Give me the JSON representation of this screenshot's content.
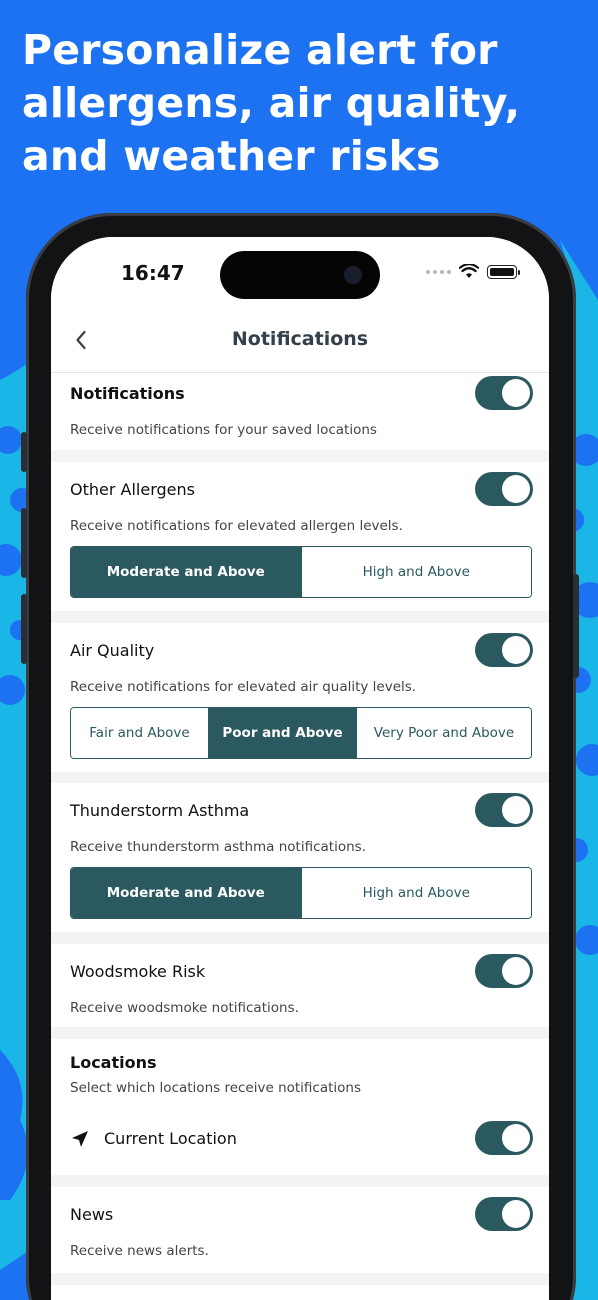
{
  "headline": "Personalize alert for allergens, air quality, and weather risks",
  "status_bar": {
    "time": "16:47"
  },
  "nav": {
    "title": "Notifications",
    "back_icon": "chevron-left-icon"
  },
  "colors": {
    "background": "#1d72f2",
    "accent": "#2a5960",
    "decor": "#1ab6e8"
  },
  "sections": {
    "notifications": {
      "title": "Notifications",
      "description": "Receive notifications for your saved locations",
      "enabled": true
    },
    "other_allergens": {
      "title": "Other Allergens",
      "description": "Receive notifications for elevated allergen levels.",
      "enabled": true,
      "options": [
        "Moderate and Above",
        "High and Above"
      ],
      "selected": "Moderate and Above"
    },
    "air_quality": {
      "title": "Air Quality",
      "description": "Receive notifications for elevated air quality levels.",
      "enabled": true,
      "options": [
        "Fair and Above",
        "Poor and Above",
        "Very Poor and Above"
      ],
      "selected": "Poor and Above"
    },
    "thunderstorm_asthma": {
      "title": "Thunderstorm Asthma",
      "description": "Receive thunderstorm asthma notifications.",
      "enabled": true,
      "options": [
        "Moderate and Above",
        "High and Above"
      ],
      "selected": "Moderate and Above"
    },
    "woodsmoke": {
      "title": "Woodsmoke Risk",
      "description": "Receive woodsmoke notifications.",
      "enabled": true
    },
    "locations": {
      "title": "Locations",
      "description": "Select which locations receive notifications",
      "items": [
        {
          "label": "Current Location",
          "icon": "location-arrow-icon",
          "enabled": true
        }
      ]
    },
    "news": {
      "title": "News",
      "description": "Receive news alerts.",
      "enabled": true
    }
  }
}
